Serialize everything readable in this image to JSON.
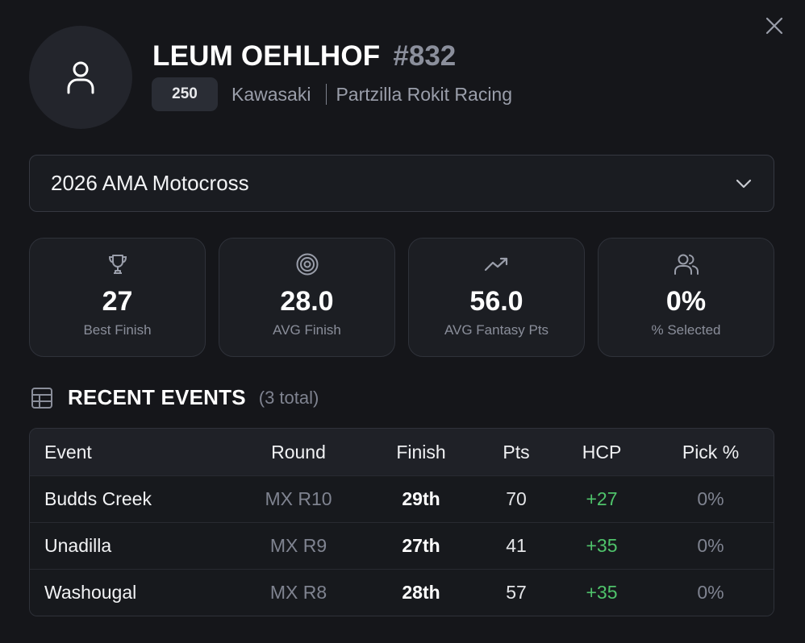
{
  "rider": {
    "name": "LEUM OEHLHOF",
    "number": "#832",
    "class": "250",
    "manufacturer": "Kawasaki",
    "team": "Partzilla Rokit Racing"
  },
  "season_select": {
    "value": "2026 AMA Motocross"
  },
  "stats": [
    {
      "icon": "trophy-icon",
      "value": "27",
      "label": "Best Finish"
    },
    {
      "icon": "target-icon",
      "value": "28.0",
      "label": "AVG Finish"
    },
    {
      "icon": "trending-up-icon",
      "value": "56.0",
      "label": "AVG Fantasy Pts"
    },
    {
      "icon": "users-icon",
      "value": "0%",
      "label": "% Selected"
    }
  ],
  "recent_events": {
    "title": "RECENT EVENTS",
    "count": "(3 total)",
    "columns": [
      "Event",
      "Round",
      "Finish",
      "Pts",
      "HCP",
      "Pick %"
    ],
    "rows": [
      {
        "event": "Budds Creek",
        "round": "MX R10",
        "finish": "29th",
        "pts": "70",
        "hcp": "+27",
        "pick": "0%"
      },
      {
        "event": "Unadilla",
        "round": "MX R9",
        "finish": "27th",
        "pts": "41",
        "hcp": "+35",
        "pick": "0%"
      },
      {
        "event": "Washougal",
        "round": "MX R8",
        "finish": "28th",
        "pts": "57",
        "hcp": "+35",
        "pick": "0%"
      }
    ]
  },
  "colors": {
    "background": "#15161a",
    "card": "#1c1e23",
    "muted_text": "#8a8e9a",
    "positive": "#4fc36b"
  }
}
